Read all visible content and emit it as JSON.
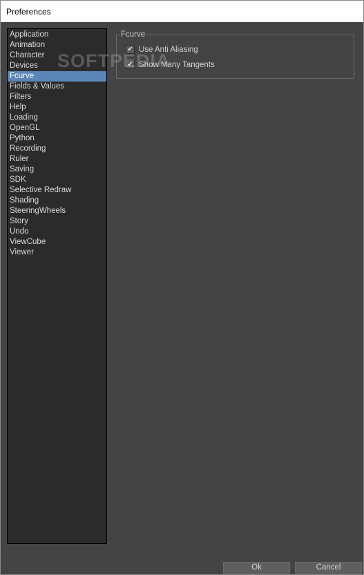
{
  "window": {
    "title": "Preferences"
  },
  "sidebar": {
    "items": [
      {
        "label": "Application",
        "selected": false
      },
      {
        "label": "Animation",
        "selected": false
      },
      {
        "label": "Character",
        "selected": false
      },
      {
        "label": "Devices",
        "selected": false
      },
      {
        "label": "Fcurve",
        "selected": true
      },
      {
        "label": "Fields & Values",
        "selected": false
      },
      {
        "label": "Filters",
        "selected": false
      },
      {
        "label": "Help",
        "selected": false
      },
      {
        "label": "Loading",
        "selected": false
      },
      {
        "label": "OpenGL",
        "selected": false
      },
      {
        "label": "Python",
        "selected": false
      },
      {
        "label": "Recording",
        "selected": false
      },
      {
        "label": "Ruler",
        "selected": false
      },
      {
        "label": "Saving",
        "selected": false
      },
      {
        "label": "SDK",
        "selected": false
      },
      {
        "label": "Selective Redraw",
        "selected": false
      },
      {
        "label": "Shading",
        "selected": false
      },
      {
        "label": "SteeringWheels",
        "selected": false
      },
      {
        "label": "Story",
        "selected": false
      },
      {
        "label": "Undo",
        "selected": false
      },
      {
        "label": "ViewCube",
        "selected": false
      },
      {
        "label": "Viewer",
        "selected": false
      }
    ]
  },
  "fcurve_group": {
    "title": "Fcurve",
    "options": [
      {
        "label": "Use Anti Aliasing",
        "checked": true
      },
      {
        "label": "Show Many Tangents",
        "checked": true
      }
    ]
  },
  "watermark": "SOFTPEDIA",
  "footer": {
    "ok_label": "Ok",
    "cancel_label": "Cancel"
  },
  "colors": {
    "background": "#444444",
    "sidebar_bg": "#2b2b2b",
    "selection": "#5a86b8",
    "button_bg": "#5e5e5e"
  },
  "icons": {
    "checkmark": "checkmark-icon"
  }
}
